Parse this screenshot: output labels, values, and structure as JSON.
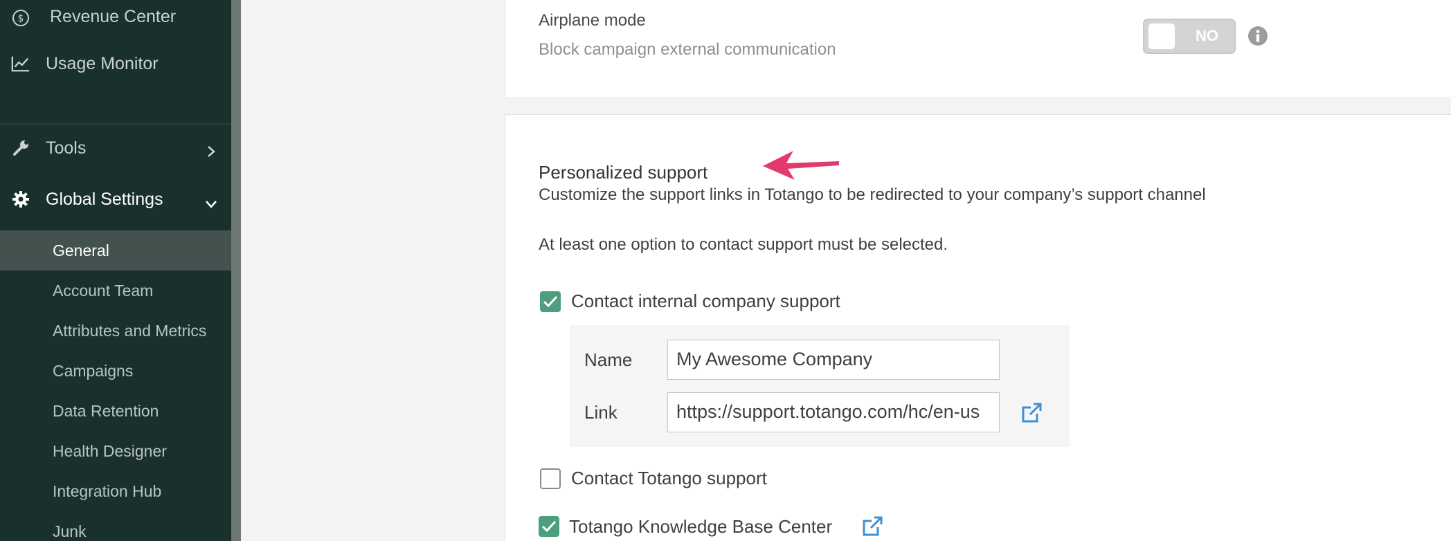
{
  "sidebar": {
    "items": [
      {
        "label": "Revenue Center",
        "icon": "dollar-circle-icon"
      },
      {
        "label": "Usage Monitor",
        "icon": "line-chart-icon"
      },
      {
        "label": "Tools",
        "icon": "wrench-icon"
      },
      {
        "label": "Global Settings",
        "icon": "gear-icon"
      }
    ],
    "sub_items": [
      {
        "label": "General",
        "active": true
      },
      {
        "label": "Account Team"
      },
      {
        "label": "Attributes and Metrics"
      },
      {
        "label": "Campaigns"
      },
      {
        "label": "Data Retention"
      },
      {
        "label": "Health Designer"
      },
      {
        "label": "Integration Hub"
      },
      {
        "label": "Junk"
      }
    ]
  },
  "airplane": {
    "title": "Airplane mode",
    "description": "Block campaign external communication",
    "toggle_state": "NO"
  },
  "support": {
    "title": "Personalized support",
    "description": "Customize the support links in Totango to be redirected to your company’s support channel",
    "note": "At least one option to contact support must be selected.",
    "internal": {
      "label": "Contact internal company support",
      "checked": true,
      "name_label": "Name",
      "name_value": "My Awesome Company",
      "link_label": "Link",
      "link_value": "https://support.totango.com/hc/en-us"
    },
    "totango": {
      "label": "Contact Totango support",
      "checked": false
    },
    "kb": {
      "label": "Totango Knowledge Base Center",
      "checked": true
    }
  },
  "colors": {
    "sidebar_bg": "#19302c",
    "check_green": "#4e9d7f",
    "link_blue": "#3f8fd2",
    "arrow_pink": "#e23a6b"
  }
}
